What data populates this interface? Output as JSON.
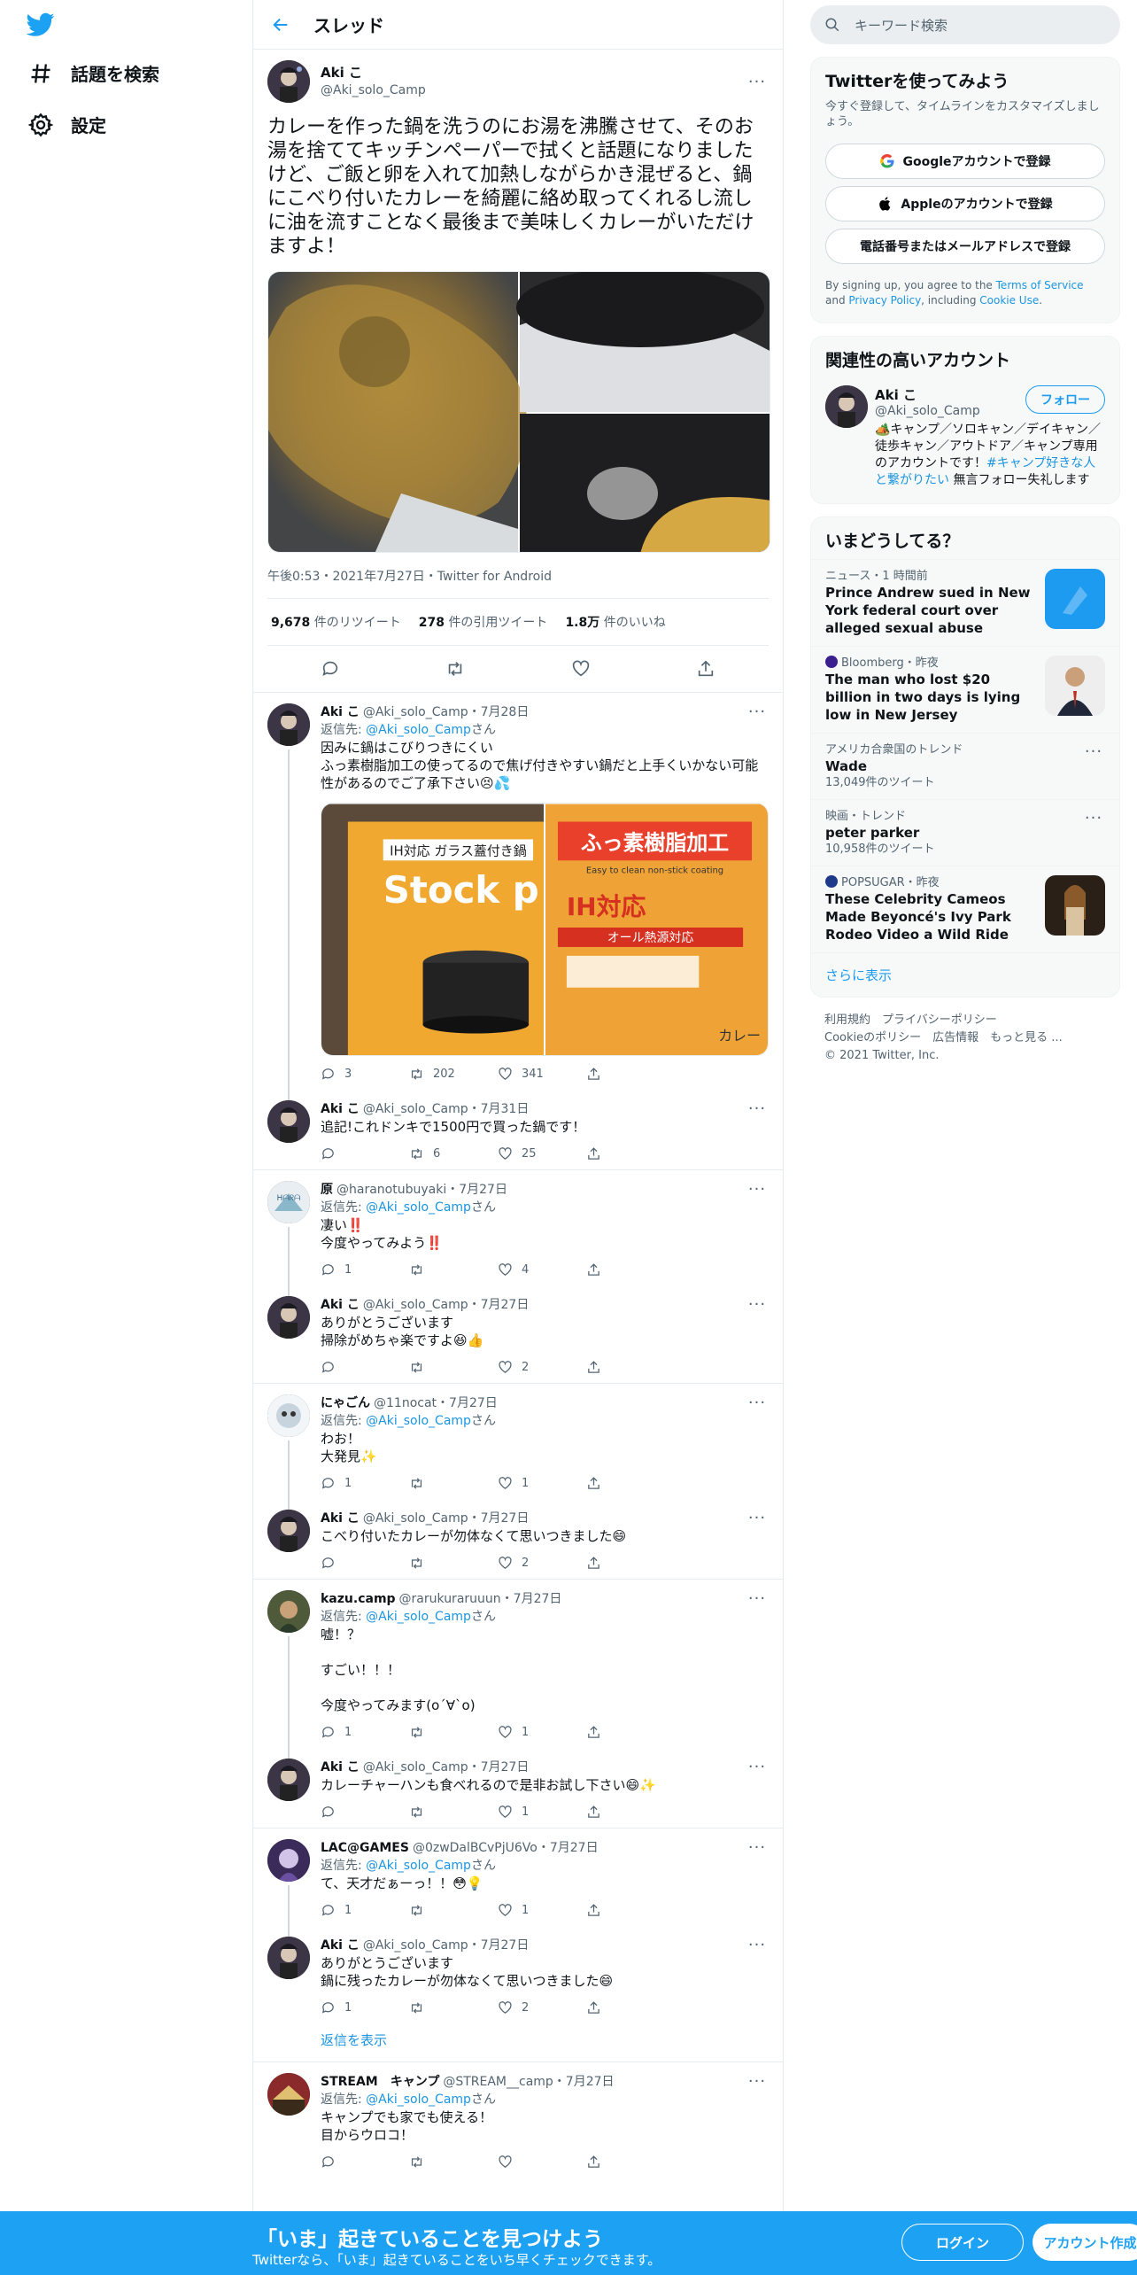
{
  "nav": {
    "explore": "話題を検索",
    "settings": "設定"
  },
  "header": {
    "title": "スレッド"
  },
  "focus": {
    "name": "Aki こ",
    "handle": "@Aki_solo_Camp",
    "text": "カレーを作った鍋を洗うのにお湯を沸騰させて、そのお湯を捨ててキッチンペーパーで拭くと話題になりましたけど、ご飯と卵を入れて加熱しながらかき混ぜると、鍋にこべり付いたカレーを綺麗に絡め取ってくれるし流しに油を流すことなく最後まで美味しくカレーがいただけますよ！",
    "meta": "午後0:53・2021年7月27日・Twitter for Android",
    "retweets": "9,678",
    "retweets_label": "件のリツイート",
    "quotes": "278",
    "quotes_label": "件の引用ツイート",
    "likes": "1.8万",
    "likes_label": "件のいいね"
  },
  "replies": [
    {
      "name": "Aki こ",
      "handle": "@Aki_solo_Camp",
      "date": "・7月28日",
      "reply_to": "@Aki_solo_Camp",
      "text": "因みに鍋はこびりつきにくい\nふっ素樹脂加工の使ってるので焦げ付きやすい鍋だと上手くいかない可能性があるのでご了承下さい😣💦",
      "reply": "3",
      "rt": "202",
      "like": "341",
      "media_left": "Stock p",
      "media_left_top": "IH対応 ガラス蓋付き鍋",
      "media_right_top": "ふっ素樹脂加工",
      "media_right_sub": "Easy to clean non-stick coating",
      "media_right_ih": "IH対応",
      "media_right_all": "オール熱源対応",
      "media_right_small": "カレー"
    },
    {
      "name": "Aki こ",
      "handle": "@Aki_solo_Camp",
      "date": "・7月31日",
      "text": "追記!これドンキで1500円で買った鍋です！",
      "reply": "",
      "rt": "6",
      "like": "25"
    },
    {
      "name": "原",
      "handle": "@haranotubuyaki",
      "date": "・7月27日",
      "reply_to": "@Aki_solo_Camp",
      "text": "凄い‼️\n今度やってみよう‼️",
      "reply": "1",
      "rt": "",
      "like": "4"
    },
    {
      "name": "Aki こ",
      "handle": "@Aki_solo_Camp",
      "date": "・7月27日",
      "text": "ありがとうございます\n掃除がめちゃ楽ですよ😆👍",
      "reply": "",
      "rt": "",
      "like": "2"
    },
    {
      "name": "にゃごん",
      "handle": "@11nocat",
      "date": "・7月27日",
      "reply_to": "@Aki_solo_Camp",
      "text": "わお！\n大発見✨",
      "reply": "1",
      "rt": "",
      "like": "1"
    },
    {
      "name": "Aki こ",
      "handle": "@Aki_solo_Camp",
      "date": "・7月27日",
      "text": "こべり付いたカレーが勿体なくて思いつきました😄",
      "reply": "",
      "rt": "",
      "like": "2"
    },
    {
      "name": "kazu.camp",
      "handle": "@rarukuraruuun",
      "date": "・7月27日",
      "reply_to": "@Aki_solo_Camp",
      "text": "嘘！？\n\nすごい！！！\n\n今度やってみます(o´∀`o)",
      "reply": "1",
      "rt": "",
      "like": "1"
    },
    {
      "name": "Aki こ",
      "handle": "@Aki_solo_Camp",
      "date": "・7月27日",
      "text": "カレーチャーハンも食べれるので是非お試し下さい😄✨",
      "reply": "",
      "rt": "",
      "like": "1"
    },
    {
      "name": "LAC@GAMES",
      "handle": "@0zwDalBCvPjU6Vo",
      "date": "・7月27日",
      "reply_to": "@Aki_solo_Camp",
      "text": "て、天才だぁーっ！！😳💡",
      "reply": "1",
      "rt": "",
      "like": "1"
    },
    {
      "name": "Aki こ",
      "handle": "@Aki_solo_Camp",
      "date": "・7月27日",
      "text": "ありがとうございます\n鍋に残ったカレーが勿体なくて思いつきました😄",
      "reply": "1",
      "rt": "",
      "like": "2"
    },
    {
      "name": "STREAM　キャンプ",
      "handle": "@STREAM__camp",
      "date": "・7月27日",
      "reply_to": "@Aki_solo_Camp",
      "text": "キャンプでも家でも使える！\n目からウロコ！",
      "reply": "",
      "rt": "",
      "like": ""
    }
  ],
  "reply_to_prefix": "返信先: ",
  "reply_to_suffix": "さん",
  "show_replies": "返信を表示",
  "search": {
    "placeholder": "キーワード検索"
  },
  "signup": {
    "title": "Twitterを使ってみよう",
    "sub": "今すぐ登録して、タイムラインをカスタマイズしましょう。",
    "google": "Googleアカウントで登録",
    "apple": "Appleのアカウントで登録",
    "phone": "電話番号またはメールアドレスで登録",
    "terms_pre": "By signing up, you agree to the ",
    "terms_link": "Terms of Service",
    "terms_and": " and ",
    "privacy_link": "Privacy Policy",
    "terms_incl": ", including ",
    "cookie_link": "Cookie Use",
    "terms_end": "."
  },
  "related": {
    "title": "関連性の高いアカウント",
    "name": "Aki こ",
    "handle": "@Aki_solo_Camp",
    "follow": "フォロー",
    "bio_pre": "🏕️キャンプ／ソロキャン／デイキャン／徒歩キャン／アウトドア／キャンプ専用のアカウントです！",
    "bio_tag": "#キャンプ好きな人と繋がりたい",
    "bio_post": " 無言フォロー失礼します"
  },
  "trends": {
    "title": "いまどうしてる？",
    "items": [
      {
        "meta": "ニュース・1 時間前",
        "title": "Prince Andrew sued in New York federal court over alleged sexual abuse",
        "count": ""
      },
      {
        "meta": "Bloomberg・昨夜",
        "title": "The man who lost $20 billion in two days is lying low in New Jersey",
        "count": ""
      },
      {
        "meta": "アメリカ合衆国のトレンド",
        "title": "Wade",
        "count": "13,049件のツイート"
      },
      {
        "meta": "映画・トレンド",
        "title": "peter parker",
        "count": "10,958件のツイート"
      },
      {
        "meta": "POPSUGAR・昨夜",
        "title": "These Celebrity Cameos Made Beyoncé's Ivy Park Rodeo Video a Wild Ride",
        "count": ""
      }
    ],
    "show_more": "さらに表示"
  },
  "footer": {
    "terms": "利用規約",
    "privacy": "プライバシーポリシー",
    "cookie": "Cookieのポリシー",
    "ads": "広告情報",
    "more": "もっと見る ...",
    "copyright": "© 2021 Twitter, Inc."
  },
  "bottom": {
    "headline": "「いま」起きていることを見つけよう",
    "sub": "Twitterなら、「いま」起きていることをいち早くチェックできます。",
    "login": "ログイン",
    "signup": "アカウント作成"
  },
  "colors": {
    "brand": "#1da1f2",
    "link": "#1b95e0"
  }
}
